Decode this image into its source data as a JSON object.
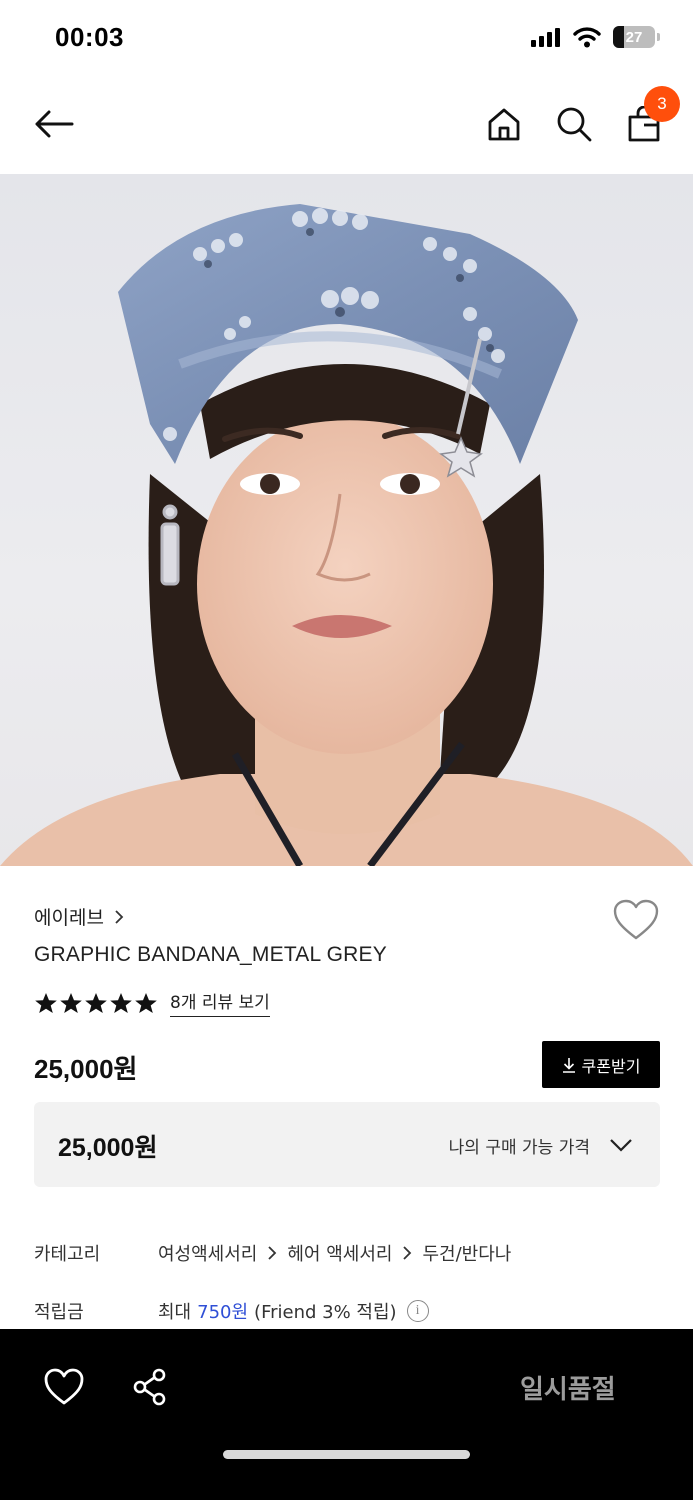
{
  "status_bar": {
    "time": "00:03",
    "battery_level": "27"
  },
  "nav": {
    "cart_count": "3",
    "icons": [
      "arrow-left-icon",
      "home-icon",
      "search-icon",
      "shopping-bag-icon"
    ]
  },
  "product": {
    "brand": "에이레브",
    "name": "GRAPHIC BANDANA_METAL GREY",
    "rating_stars": 5,
    "review_link": "8개 리뷰 보기",
    "price": "25,000원",
    "coupon_label": "쿠폰받기",
    "my_price": "25,000원",
    "my_price_label": "나의 구매 가능 가격"
  },
  "details": {
    "category_label": "카테고리",
    "category_path": [
      "여성액세서리",
      "헤어 액세서리",
      "두건/반다나"
    ],
    "points_label": "적립금",
    "points_prefix": "최대",
    "points_amount": "750원",
    "points_suffix": "(Friend 3% 적립)"
  },
  "bottom_bar": {
    "soldout_label": "일시품절"
  },
  "colors": {
    "accent_badge": "#ff4f0c",
    "points_link": "#2f4fd6",
    "bandana": "#7e93b8"
  }
}
